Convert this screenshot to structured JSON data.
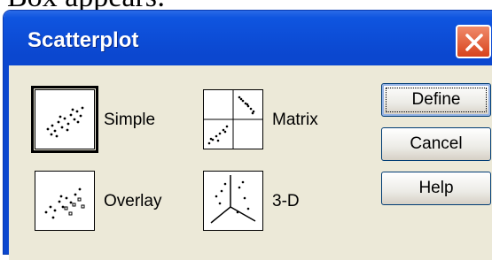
{
  "background_text": "Box appears:",
  "dialog": {
    "title": "Scatterplot",
    "options": [
      {
        "label": "Simple",
        "icon": "simple-scatter-icon",
        "selected": true
      },
      {
        "label": "Overlay",
        "icon": "overlay-scatter-icon",
        "selected": false
      },
      {
        "label": "Matrix",
        "icon": "matrix-scatter-icon",
        "selected": false
      },
      {
        "label": "3-D",
        "icon": "3d-scatter-icon",
        "selected": false
      }
    ],
    "buttons": {
      "define": "Define",
      "cancel": "Cancel",
      "help": "Help"
    }
  },
  "colors": {
    "titlebar": "#0b47cf",
    "close": "#d8431c",
    "client": "#ece9d8"
  }
}
